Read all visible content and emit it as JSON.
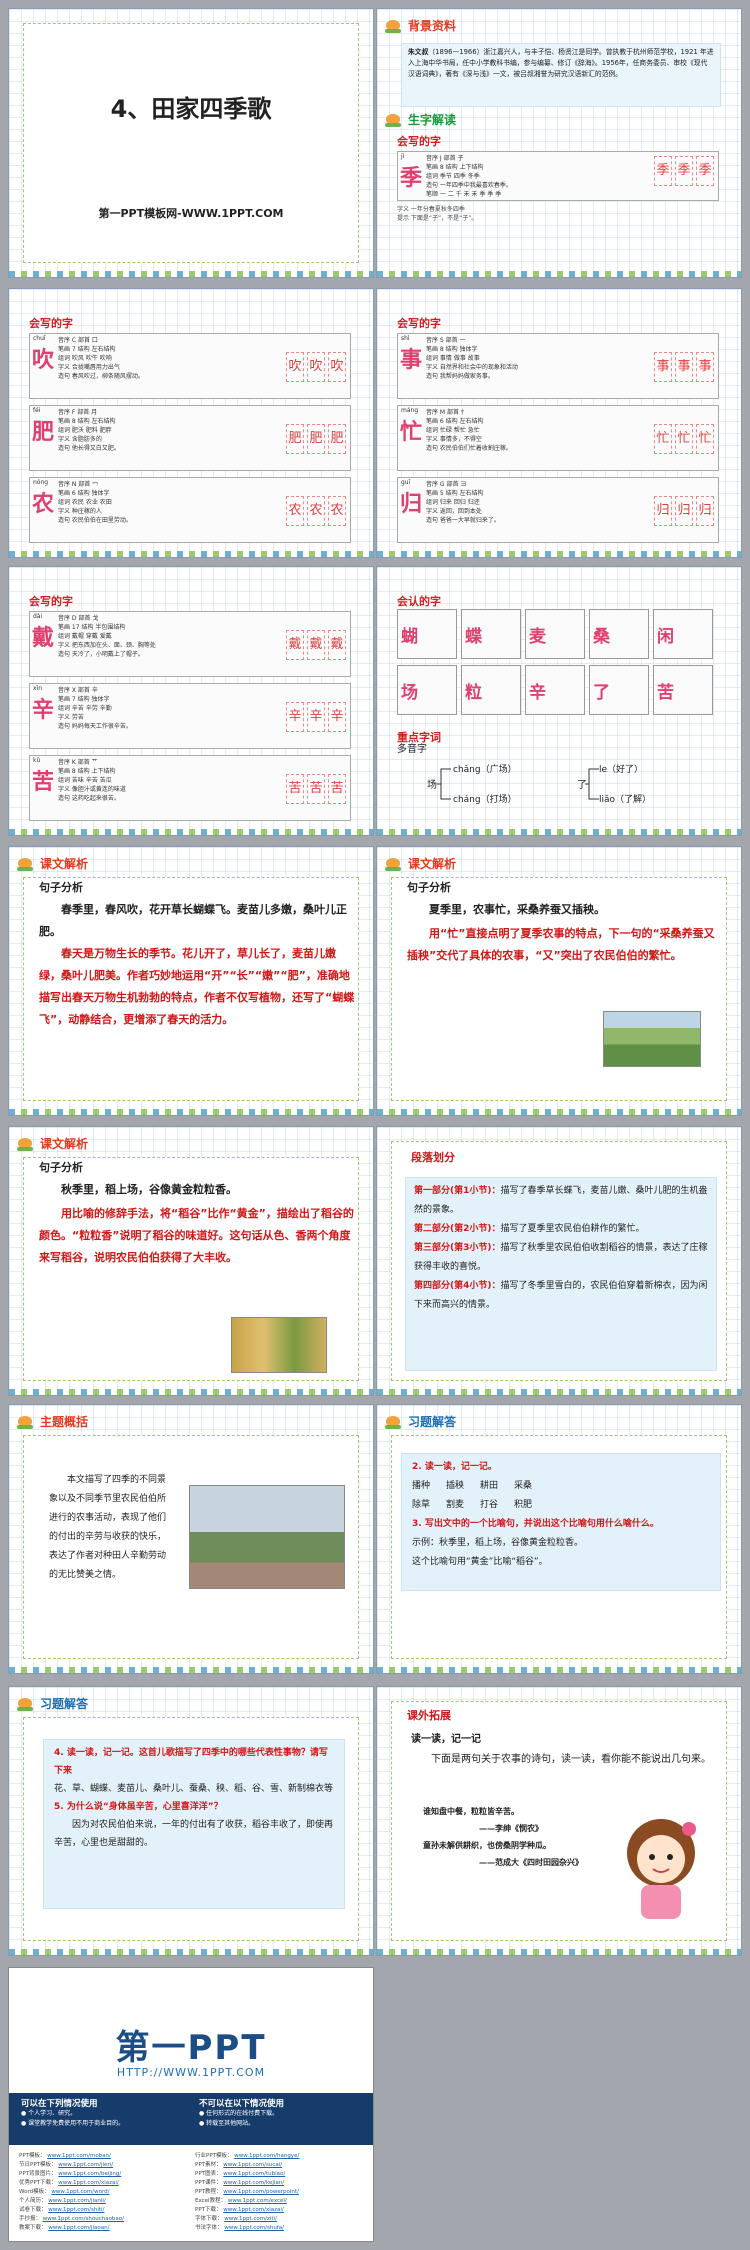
{
  "s1": {
    "title": "4、田家四季歌",
    "sub": "第一PPT模板网-WWW.1PPT.COM"
  },
  "s2": {
    "r1": "背景资料",
    "bg1": "朱文叔",
    "bg2": "（1896—1966）浙江嘉兴人，与丰子恺、杨贤江是同学。曾执教于杭州师范学校，1921 年进入上海中华书局，任中小学教科书编，参与编纂、修订《辞海》。1956年，任商务委员、审校《现代汉语词典》，著有《深与浅》一文，被吕叔湘誉为研究汉语新汇的范例。",
    "r2": "生字解读",
    "sec": "会写的字",
    "row": {
      "ch": "季",
      "py": "jì",
      "l1": "音序 J  部首 子",
      "l2": "笔画 8  结构 上下结构",
      "l3": "组词 季节 四季 冬季",
      "l4": "造句 一年四季中我最喜欢春季。",
      "l5": "笔顺 一 二 千 禾 禾 季 季 季",
      "l6": "字义 一年分春夏秋冬四季",
      "l7": "提示 下面是“子”，不是“子”。",
      "p1": "季",
      "p2": "季",
      "p3": "季"
    }
  },
  "s3": {
    "sec": "会写的字",
    "rows": [
      {
        "ch": "吹",
        "py": "chuī",
        "l1": "音序 C  部首 口",
        "l2": "笔画 7  结构 左右结构",
        "l3": "组词 吹风 吹牛 吹响",
        "l4": "字义 合拢嘴唇用力出气",
        "l5": "造句 春风吹过，柳条随风摆动。",
        "p1": "吹",
        "p2": "吹",
        "p3": "吹"
      },
      {
        "ch": "肥",
        "py": "féi",
        "l1": "音序 F  部首 月",
        "l2": "笔画 8  结构 左右结构",
        "l3": "组词 肥沃 肥料 肥胖",
        "l4": "字义 含脂肪多的",
        "l5": "造句 他长得又白又肥。",
        "p1": "肥",
        "p2": "肥",
        "p3": "肥"
      },
      {
        "ch": "农",
        "py": "nóng",
        "l1": "音序 N  部首 冖",
        "l2": "笔画 6  结构 独体字",
        "l3": "组词 农民 农业 农田",
        "l4": "字义 种庄稼的人",
        "l5": "造句 农民伯伯在田里劳动。",
        "p1": "农",
        "p2": "农",
        "p3": "农"
      }
    ]
  },
  "s4": {
    "sec": "会写的字",
    "rows": [
      {
        "ch": "事",
        "py": "shì",
        "l1": "音序 S  部首 一",
        "l2": "笔画 8  结构 独体字",
        "l3": "组词 事情 做事 故事",
        "l4": "字义 自然界和社会中的现象和活动",
        "l5": "造句 我帮妈妈做家务事。",
        "p1": "事",
        "p2": "事",
        "p3": "事"
      },
      {
        "ch": "忙",
        "py": "máng",
        "l1": "音序 M  部首 忄",
        "l2": "笔画 6  结构 左右结构",
        "l3": "组词 忙碌 帮忙 急忙",
        "l4": "字义 事情多，不得空",
        "l5": "造句 农民伯伯们忙着收割庄稼。",
        "p1": "忙",
        "p2": "忙",
        "p3": "忙"
      },
      {
        "ch": "归",
        "py": "guī",
        "l1": "音序 G  部首 彐",
        "l2": "笔画 5  结构 左右结构",
        "l3": "组词 归来 回归 归还",
        "l4": "字义 返回，回到本处",
        "l5": "造句 爸爸一大早就归来了。",
        "p1": "归",
        "p2": "归",
        "p3": "归"
      }
    ]
  },
  "s5": {
    "sec": "会写的字",
    "rows": [
      {
        "ch": "戴",
        "py": "dài",
        "l1": "音序 D  部首 戈",
        "l2": "笔画 17  结构 半包围结构",
        "l3": "组词 戴帽 穿戴 爱戴",
        "l4": "字义 把东西加在头、面、颈、胸等处",
        "l5": "造句 天冷了，小明戴上了帽子。",
        "p1": "戴",
        "p2": "戴",
        "p3": "戴"
      },
      {
        "ch": "辛",
        "py": "xīn",
        "l1": "音序 X  部首 辛",
        "l2": "笔画 7  结构 独体字",
        "l3": "组词 辛苦 辛劳 辛勤",
        "l4": "字义 劳苦",
        "l5": "造句 妈妈每天工作很辛苦。",
        "p1": "辛",
        "p2": "辛",
        "p3": "辛"
      },
      {
        "ch": "苦",
        "py": "kǔ",
        "l1": "音序 K  部首 艹",
        "l2": "笔画 8  结构 上下结构",
        "l3": "组词 苦味 辛苦 苦瓜",
        "l4": "字义 像胆汁或黄连的味道",
        "l5": "造句 这药吃起来很苦。",
        "p1": "苦",
        "p2": "苦",
        "p3": "苦"
      }
    ]
  },
  "s6": {
    "sec": "会认的字",
    "chars": [
      "蝴",
      "蝶",
      "麦",
      "桑",
      "闲",
      "场",
      "粒",
      "辛",
      "了",
      "苦"
    ],
    "sec2": "重点字词",
    "poly": "多音字",
    "chang": "场",
    "c1": "chǎng（广场）",
    "c2": "cháng（打场）",
    "liao": "了",
    "l1": "le（好了）",
    "l2": "liǎo（了解）"
  },
  "s7": {
    "r": "课文解析",
    "h": "句子分析",
    "p1": "春季里，春风吹，花开草长蝴蝶飞。麦苗儿多嫩，桑叶儿正肥。",
    "p2": "春天是万物生长的季节。花儿开了，草儿长了，麦苗儿嫩绿，桑叶儿肥美。作者巧妙地运用“开”“长”“嫩”“肥”，准确地描写出春天万物生机勃勃的特点，作者不仅写植物，还写了“蝴蝶飞”，动静结合，更增添了春天的活力。"
  },
  "s8": {
    "r": "课文解析",
    "h": "句子分析",
    "p1": "夏季里，农事忙，采桑养蚕又插秧。",
    "p2": "用“忙”直接点明了夏季农事的特点，下一句的“采桑养蚕又插秧”交代了具体的农事，“又”突出了农民伯伯的繁忙。"
  },
  "s9": {
    "r": "课文解析",
    "h": "句子分析",
    "p1": "秋季里，稻上场，谷像黄金粒粒香。",
    "p2": "用比喻的修辞手法，将“稻谷”比作“黄金”，描绘出了稻谷的颜色。“粒粒香”说明了稻谷的味道好。这句话从色、香两个角度来写稻谷，说明农民伯伯获得了大丰收。"
  },
  "s10": {
    "h": "段落划分",
    "a1": "第一部分(第1小节)：",
    "t1": "描写了春季草长蝶飞，麦苗儿嫩、桑叶儿肥的生机盎然的景象。",
    "a2": "第二部分(第2小节)：",
    "t2": "描写了夏季里农民伯伯耕作的繁忙。",
    "a3": "第三部分(第3小节)：",
    "t3": "描写了秋季里农民伯伯收割稻谷的情景，表达了庄稼获得丰收的喜悦。",
    "a4": "第四部分(第4小节)：",
    "t4": "描写了冬季里雪白的，农民伯伯穿着新棉衣，因为闲下来而高兴的情景。"
  },
  "s11": {
    "r": "主题概括",
    "p": "本文描写了四季的不同景象以及不同季节里农民伯伯所进行的农事活动，表现了他们的付出的辛劳与收获的快乐，表达了作者对种田人辛勤劳动的无比赞美之情。"
  },
  "s12": {
    "r": "习题解答",
    "q1": "2. 读一读，记一记。",
    "w1": [
      "播种",
      "插秧",
      "耕田",
      "采桑"
    ],
    "w2": [
      "除草",
      "割麦",
      "打谷",
      "积肥"
    ],
    "q2": "3. 写出文中的一个比喻句，并说出这个比喻句用什么喻什么。",
    "a2a": "示例：秋季里，稻上场，谷像黄金粒粒香。",
    "a2b": "这个比喻句用“黄金”比喻“稻谷”。"
  },
  "s13": {
    "r": "习题解答",
    "q1": "4. 读一读，记一记。这首儿歌描写了四季中的哪些代表性事物？请写下来",
    "a1": "花、草、蝴蝶、麦苗儿、桑叶儿、蚕桑、秧、稻、谷、雪、新制棉衣等",
    "q2": "5. 为什么说“身体虽辛苦，心里喜洋洋”？",
    "a2": "因为对农民伯伯来说，一年的付出有了收获，稻谷丰收了，即使再辛苦，心里也是甜甜的。"
  },
  "s14": {
    "h": "课外拓展",
    "sub": "读一读，记一记",
    "intro": "下面是两句关于农事的诗句，读一读，看你能不能说出几句来。",
    "v1": "谁知盘中餐，粒粒皆辛苦。",
    "v1a": "——李绅《悯农》",
    "v2": "童孙未解供耕织，也傍桑阴学种瓜。",
    "v2a": "——范成大《四时田园杂兴》"
  },
  "last": {
    "logo": "第一PPT",
    "url": "HTTP://WWW.1PPT.COM",
    "h1": "可以在下列情况使用",
    "b1": "● 个人学习、研究。",
    "b2": "● 课堂教学免费使用不用于商业目的。",
    "h2": "不可以在以下情况使用",
    "b3": "● 任何形式的在线付费下载。",
    "b4": "● 转载至其他网站。",
    "col1": [
      [
        "PPT模板：",
        "www.1ppt.com/moban/"
      ],
      [
        "节日PPT模板：",
        "www.1ppt.com/jieri/"
      ],
      [
        "PPT背景图片：",
        "www.1ppt.com/beijing/"
      ],
      [
        "优秀PPT下载：",
        "www.1ppt.com/xiazai/"
      ],
      [
        "Word模板：",
        "www.1ppt.com/word/"
      ],
      [
        "个人简历：",
        "www.1ppt.com/jianli/"
      ],
      [
        "试卷下载：",
        "www.1ppt.com/shiti/"
      ],
      [
        "手抄报：",
        "www.1ppt.com/shouchaobao/"
      ],
      [
        "教案下载：",
        "www.1ppt.com/jiaoan/"
      ]
    ],
    "col2": [
      [
        "行业PPT模板：",
        "www.1ppt.com/hangye/"
      ],
      [
        "PPT素材：",
        "www.1ppt.com/sucai/"
      ],
      [
        "PPT图表：",
        "www.1ppt.com/tubiao/"
      ],
      [
        "PPT课件：",
        "www.1ppt.com/kejian/"
      ],
      [
        "PPT教程：",
        "www.1ppt.com/powerpoint/"
      ],
      [
        "Excel教程：",
        "www.1ppt.com/excel/"
      ],
      [
        "PPT下载：",
        "www.1ppt.com/xiazai/"
      ],
      [
        "字体下载：",
        "www.1ppt.com/ziti/"
      ],
      [
        "书法字体：",
        "www.1ppt.com/shufa/"
      ]
    ]
  }
}
